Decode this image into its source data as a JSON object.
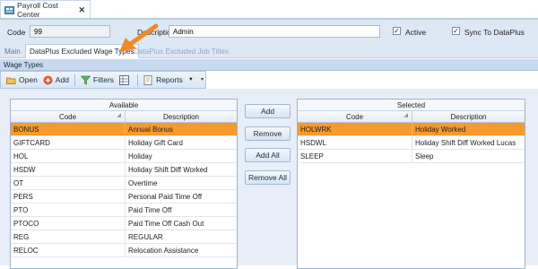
{
  "document_tab": {
    "title": "Payroll Cost Center",
    "close_icon": "close-icon"
  },
  "form": {
    "code_label": "Code",
    "code_value": "99",
    "description_label": "Description",
    "description_value": "Admin",
    "active_label": "Active",
    "active_checked": true,
    "sync_label": "Sync To DataPlus",
    "sync_checked": true
  },
  "tabs": [
    {
      "label": "Main",
      "state": "inactive"
    },
    {
      "label": "DataPlus Excluded Wage Types",
      "state": "active"
    },
    {
      "label": "DataPlus Excluded Job Titles",
      "state": "disabled"
    }
  ],
  "section_title": "Wage Types",
  "toolbar": {
    "open_label": "Open",
    "add_label": "Add",
    "filters_label": "Filters",
    "reports_label": "Reports"
  },
  "available": {
    "title": "Available",
    "columns": [
      "Code",
      "Description"
    ],
    "rows": [
      {
        "code": "BONUS",
        "description": "Annual Bonus",
        "selected": true
      },
      {
        "code": "GIFTCARD",
        "description": "Holiday Gift Card",
        "selected": false
      },
      {
        "code": "HOL",
        "description": "Holiday",
        "selected": false
      },
      {
        "code": "HSDW",
        "description": "Holiday Shift Diff Worked",
        "selected": false
      },
      {
        "code": "OT",
        "description": "Overtime",
        "selected": false
      },
      {
        "code": "PERS",
        "description": "Personal Paid Time Off",
        "selected": false
      },
      {
        "code": "PTO",
        "description": "Paid Time Off",
        "selected": false
      },
      {
        "code": "PTOCO",
        "description": "Paid Time Off Cash Out",
        "selected": false
      },
      {
        "code": "REG",
        "description": "REGULAR",
        "selected": false
      },
      {
        "code": "RELOC",
        "description": "Relocation Assistance",
        "selected": false
      }
    ]
  },
  "buttons": {
    "add": "Add",
    "remove": "Remove",
    "add_all": "Add All",
    "remove_all": "Remove All"
  },
  "selected": {
    "title": "Selected",
    "columns": [
      "Code",
      "Description"
    ],
    "rows": [
      {
        "code": "HOLWRK",
        "description": "Holiday Worked",
        "selected": true
      },
      {
        "code": "HSDWL",
        "description": "Holiday Shift Diff Worked Lucas",
        "selected": false
      },
      {
        "code": "SLEEP",
        "description": "Sleep",
        "selected": false
      }
    ]
  },
  "colors": {
    "accent_orange": "#f79a2e",
    "panel_blue": "#dde8f5",
    "header_blue": "#c6d9ef"
  }
}
